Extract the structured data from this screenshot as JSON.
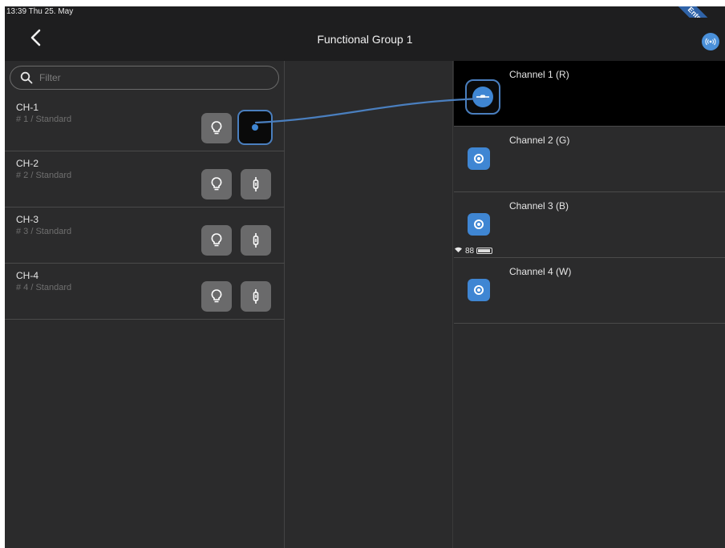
{
  "status_bar": {
    "time_date": "13:39  Thu 25. May",
    "battery": "88",
    "corner_badge": "Enterprise"
  },
  "header": {
    "title": "Functional Group 1",
    "back_icon": "chevron-left-icon",
    "network_icon": "broadcast-icon"
  },
  "filter": {
    "placeholder": "Filter",
    "value": ""
  },
  "devices": [
    {
      "name": "CH-1",
      "sub": "# 1 / Standard",
      "connected": true
    },
    {
      "name": "CH-2",
      "sub": "# 2 / Standard",
      "connected": false
    },
    {
      "name": "CH-3",
      "sub": "# 3 / Standard",
      "connected": false
    },
    {
      "name": "CH-4",
      "sub": "# 4 / Standard",
      "connected": false
    }
  ],
  "channels": [
    {
      "label": "Channel 1 (R)",
      "selected": true
    },
    {
      "label": "Channel 2 (G)",
      "selected": false
    },
    {
      "label": "Channel 3 (B)",
      "selected": false
    },
    {
      "label": "Channel 4 (W)",
      "selected": false
    }
  ],
  "colors": {
    "accent": "#3f86d3",
    "wire": "#4a7fbf",
    "background": "#2b2b2c",
    "bar": "#1e1e1f"
  }
}
